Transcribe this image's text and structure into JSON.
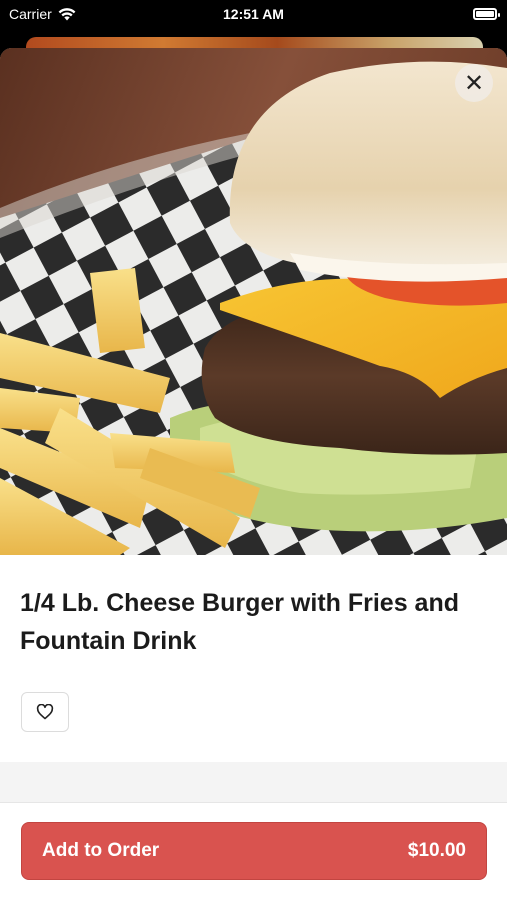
{
  "status_bar": {
    "carrier": "Carrier",
    "time": "12:51 AM",
    "wifi_icon": "wifi-icon",
    "battery_icon": "battery-icon"
  },
  "item": {
    "name": "1/4 Lb. Cheese Burger with Fries and Fountain Drink",
    "image": "burger-and-fries-photo",
    "close_icon": "close-icon",
    "favorite_icon": "heart-icon"
  },
  "order_button": {
    "label": "Add to Order",
    "price": "$10.00"
  },
  "colors": {
    "accent": "#d9534f",
    "text": "#1b1b1b"
  }
}
